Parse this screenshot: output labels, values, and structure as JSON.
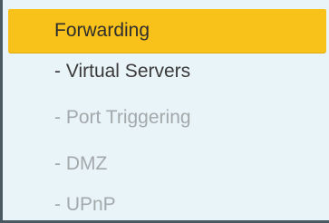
{
  "menu": {
    "header": "Forwarding",
    "items": [
      {
        "label": "- Virtual Servers",
        "state": "active"
      },
      {
        "label": "- Port Triggering",
        "state": "inactive"
      },
      {
        "label": "- DMZ",
        "state": "inactive"
      },
      {
        "label": "- UPnP",
        "state": "inactive"
      }
    ]
  },
  "colors": {
    "header_bg": "#f9c21a",
    "panel_bg": "#e8f4f7",
    "active_text": "#3a3a3a",
    "inactive_text": "#a4a9ab",
    "border": "#4a5a63"
  }
}
